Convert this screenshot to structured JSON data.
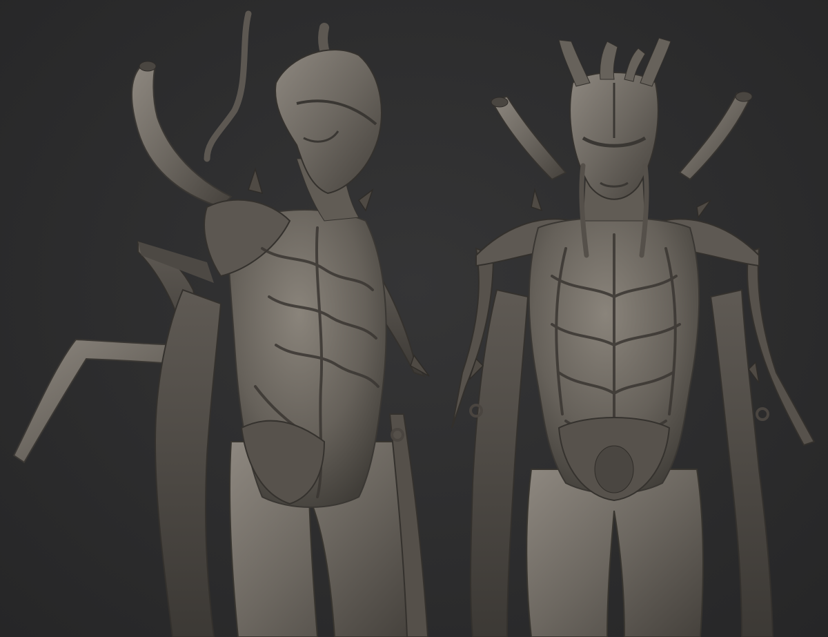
{
  "scene": {
    "background_color": "#2d2d2e",
    "material_color": "#6f6a64",
    "material_shadow_color": "#3b3833",
    "material_highlight_color": "#9c968d"
  },
  "figures": [
    {
      "label_name": "alien-sculpt-three-quarter-view"
    },
    {
      "label_name": "alien-sculpt-front-view"
    }
  ]
}
